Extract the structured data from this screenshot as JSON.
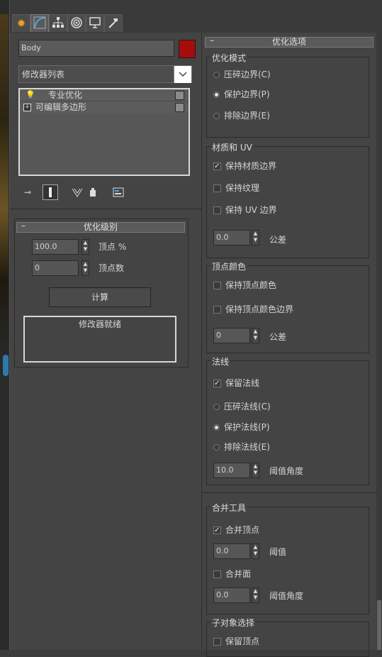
{
  "tabs": [
    {
      "icon": "create-icon"
    },
    {
      "icon": "modify-icon"
    },
    {
      "icon": "hierarchy-icon"
    },
    {
      "icon": "motion-icon"
    },
    {
      "icon": "display-icon"
    },
    {
      "icon": "utilities-icon"
    }
  ],
  "object": {
    "name": "Body",
    "color": "#a70b0b"
  },
  "modifier_list": {
    "label": "修改器列表"
  },
  "stack": [
    {
      "label": "专业优化",
      "icon": "lightbulb-icon"
    },
    {
      "label": "可编辑多边形",
      "icon": "plus-box-icon"
    }
  ],
  "stack_tools": [
    "pin-stack-icon",
    "show-end-result-icon",
    "make-unique-icon",
    "remove-modifier-icon",
    "configure-modifier-sets-icon"
  ],
  "optimization_level": {
    "title": "优化级别",
    "vertex_percent": {
      "value": "100.0",
      "label": "顶点 %"
    },
    "vertex_count": {
      "value": "0",
      "label": "顶点数"
    },
    "calculate_label": "计算",
    "status": "修改器就绪"
  },
  "options": {
    "title": "优化选项",
    "mode": {
      "title": "优化模式",
      "items": [
        {
          "label": "压碎边界(C)",
          "selected": false
        },
        {
          "label": "保护边界(P)",
          "selected": true
        },
        {
          "label": "排除边界(E)",
          "selected": false
        }
      ]
    },
    "material_uv": {
      "title": "材质和 UV",
      "items": [
        {
          "label": "保持材质边界",
          "checked": true
        },
        {
          "label": "保持纹理",
          "checked": false
        },
        {
          "label": "保持 UV 边界",
          "checked": false
        }
      ],
      "tolerance": {
        "value": "0.0",
        "label": "公差"
      }
    },
    "vertex_color": {
      "title": "顶点颜色",
      "items": [
        {
          "label": "保持顶点颜色",
          "checked": false
        },
        {
          "label": "保持顶点颜色边界",
          "checked": false
        }
      ],
      "tolerance": {
        "value": "0",
        "label": "公差"
      }
    },
    "normals": {
      "title": "法线",
      "keep": {
        "label": "保留法线",
        "checked": true
      },
      "items": [
        {
          "label": "压碎法线(C)",
          "selected": false
        },
        {
          "label": "保护法线(P)",
          "selected": true
        },
        {
          "label": "排除法线(E)",
          "selected": false
        }
      ],
      "threshold": {
        "value": "10.0",
        "label": "阈值角度"
      }
    },
    "merge": {
      "title": "合并工具",
      "merge_verts": {
        "label": "合并顶点",
        "checked": true
      },
      "threshold": {
        "value": "0.0",
        "label": "阈值"
      },
      "merge_faces": {
        "label": "合并面",
        "checked": false
      },
      "face_threshold": {
        "value": "0.0",
        "label": "阈值角度"
      }
    },
    "subobject": {
      "title": "子对象选择",
      "keep_verts": {
        "label": "保留顶点",
        "checked": false
      }
    }
  }
}
